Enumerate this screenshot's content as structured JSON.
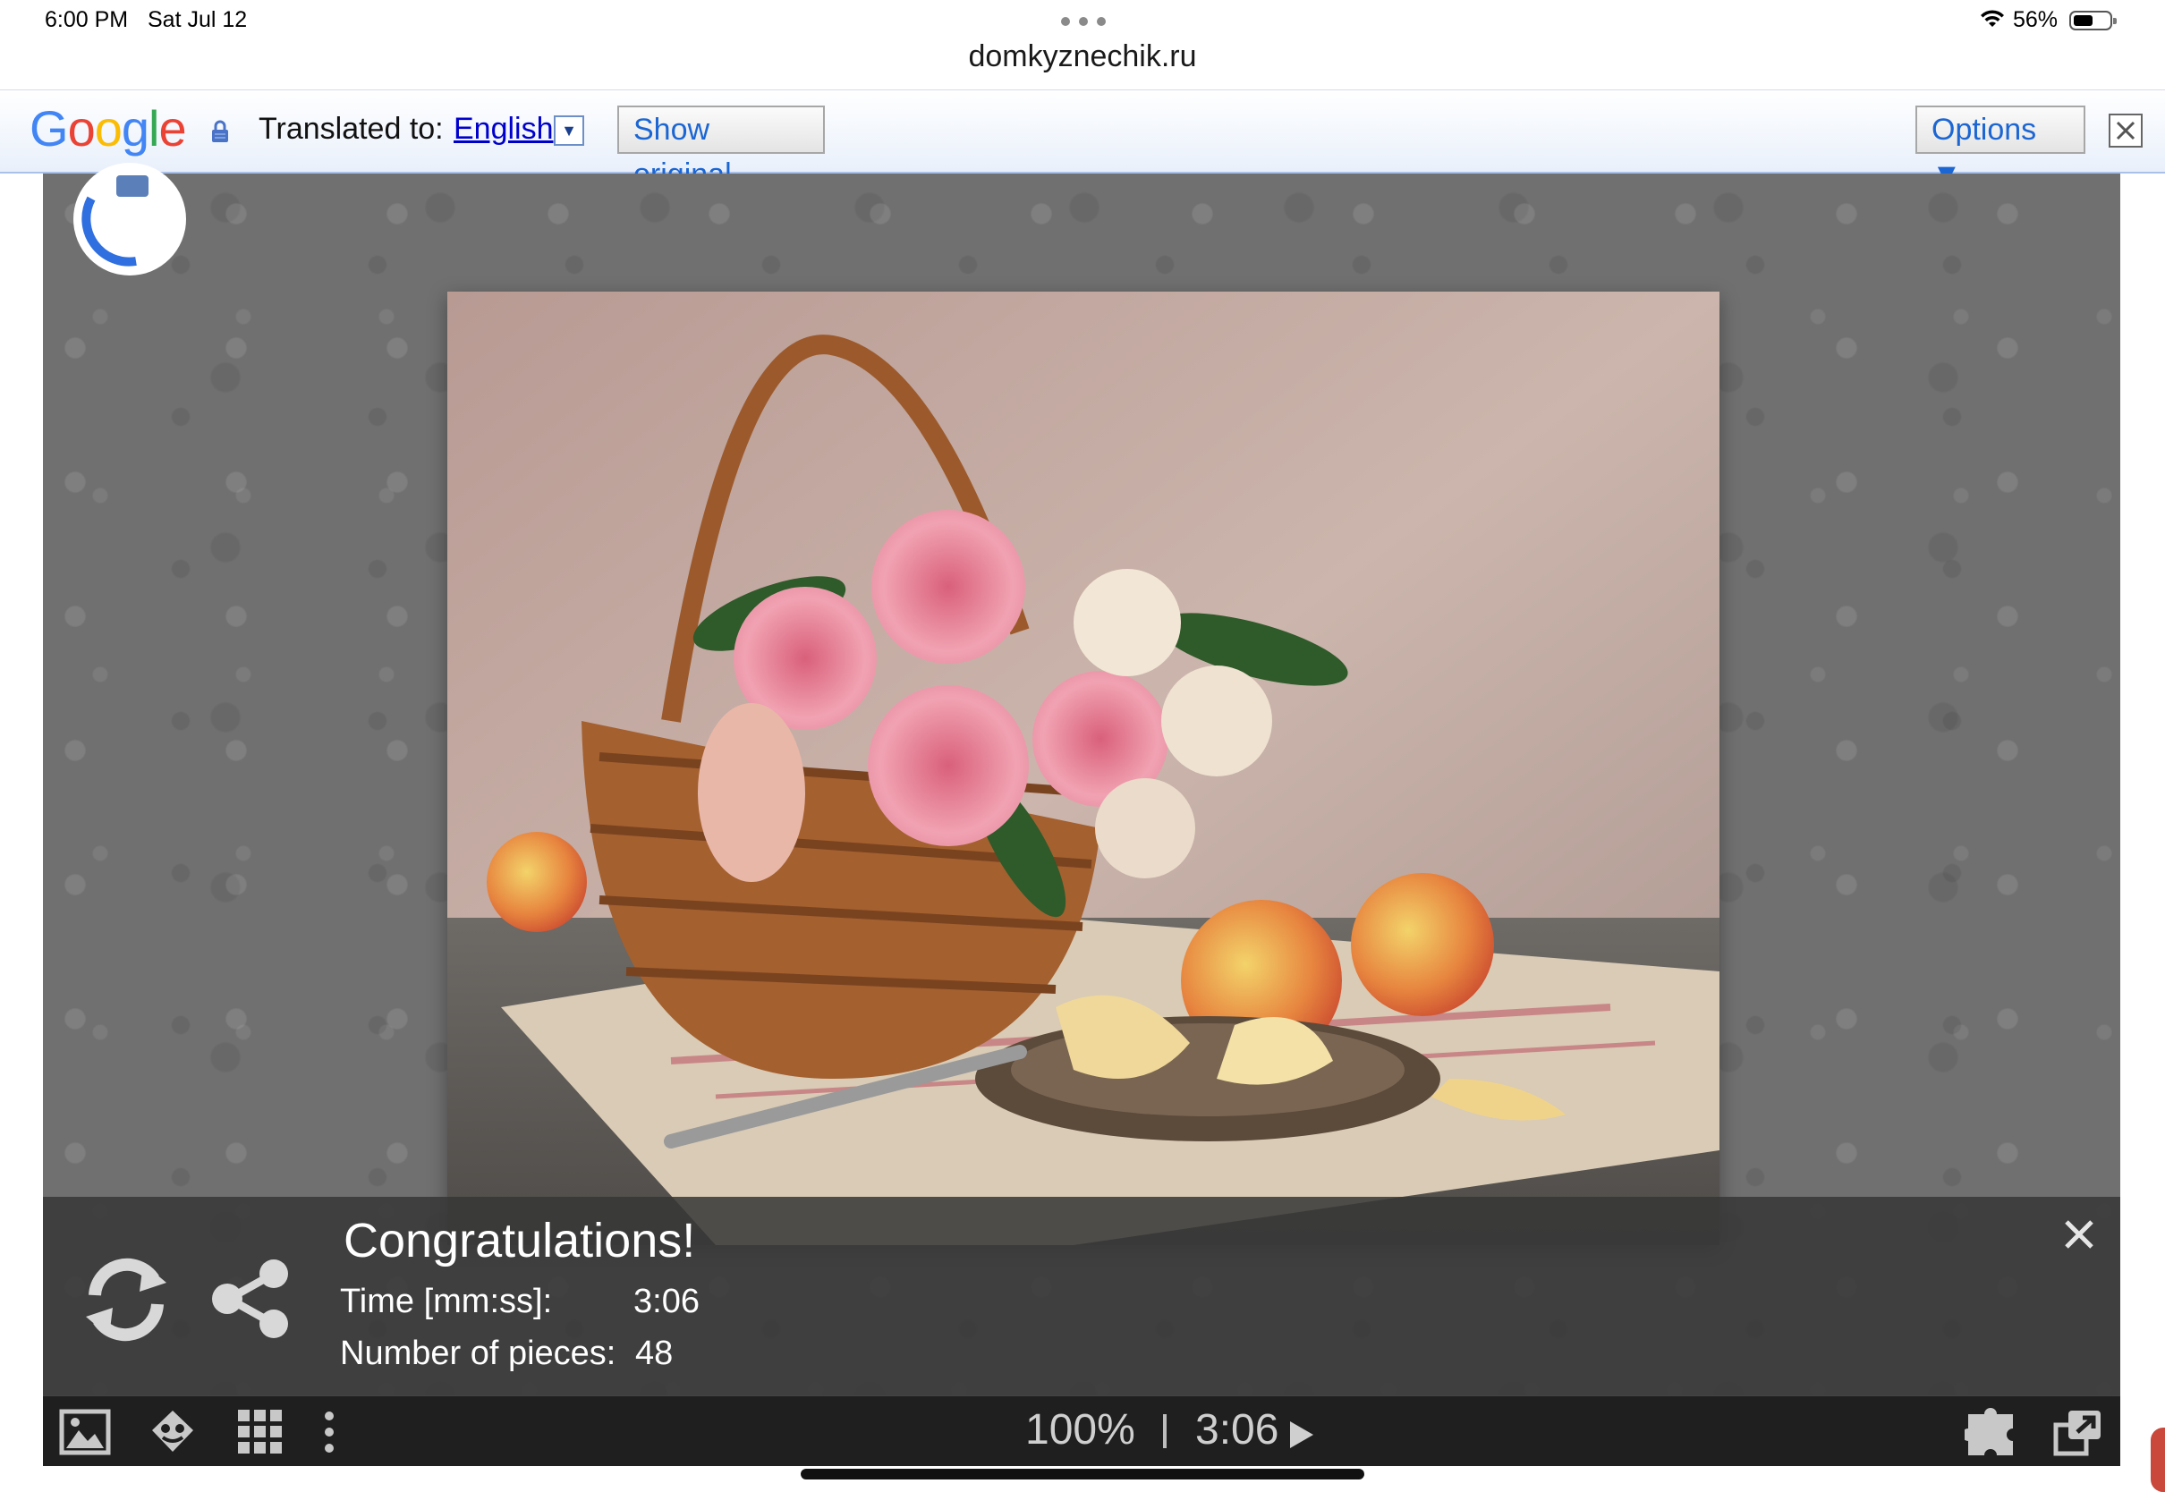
{
  "status_bar": {
    "time": "6:00 PM",
    "date": "Sat Jul 12",
    "battery_percent": "56%",
    "battery_level": 0.56
  },
  "browser": {
    "url": "domkyznechik.ru"
  },
  "translate_bar": {
    "logo": "Google",
    "translated_to_label": "Translated to:",
    "language": "English",
    "show_original_label": "Show original",
    "options_label": "Options ▼"
  },
  "congrats_panel": {
    "title": "Congratulations!",
    "time_label": "Time [mm:ss]:",
    "time_value": "3:06",
    "pieces_label": "Number of pieces:",
    "pieces_value": "48"
  },
  "toolbar": {
    "zoom": "100%",
    "timer": "3:06",
    "icons": [
      "image-icon",
      "ghost-icon",
      "grid-icon",
      "more-icon",
      "puzzle-piece-icon",
      "fullscreen-icon"
    ]
  },
  "colors": {
    "google_blue": "#4285f4",
    "google_red": "#ea4335",
    "google_yellow": "#fbbc05",
    "google_green": "#34a853",
    "link_blue": "#0000cc",
    "panel_bg": "#373737",
    "toolbar_bg": "#1f1f1f"
  }
}
